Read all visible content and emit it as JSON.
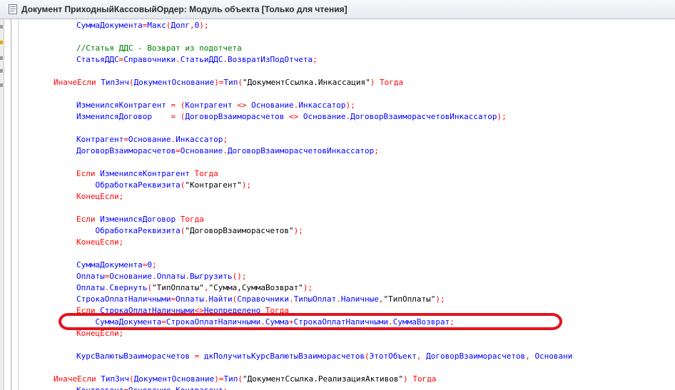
{
  "window": {
    "title": "Документ ПриходныйКассовыйОрдер: Модуль объекта [Только для чтения]",
    "icon": "module-document-icon"
  },
  "accent_colors": {
    "keyword": "#ff0000",
    "identifier": "#0000ff",
    "comment": "#008000",
    "annotation": "#e0141e"
  },
  "code_lines": [
    [
      {
        "t": "СуммаДокумента",
        "c": "id"
      },
      {
        "t": "=",
        "c": "op"
      },
      {
        "t": "Макс",
        "c": "id"
      },
      {
        "t": "(",
        "c": "op"
      },
      {
        "t": "Долг",
        "c": "id"
      },
      {
        "t": ",",
        "c": "op"
      },
      {
        "t": "0",
        "c": "id"
      },
      {
        "t": ");",
        "c": "op"
      }
    ],
    [],
    [
      {
        "t": "//Статья ДДС - Возврат из подотчета",
        "c": "cm"
      }
    ],
    [
      {
        "t": "СтатьяДДС",
        "c": "id"
      },
      {
        "t": "=",
        "c": "op"
      },
      {
        "t": "Справочники",
        "c": "id"
      },
      {
        "t": ".",
        "c": "op"
      },
      {
        "t": "СтатьиДДС",
        "c": "id"
      },
      {
        "t": ".",
        "c": "op"
      },
      {
        "t": "ВозвратИзПодОтчета",
        "c": "id"
      },
      {
        "t": ";",
        "c": "op"
      }
    ],
    [],
    [
      {
        "t": "ИначеЕсли ",
        "c": "kw"
      },
      {
        "t": "ТипЗнч",
        "c": "id"
      },
      {
        "t": "(",
        "c": "op"
      },
      {
        "t": "ДокументОснование",
        "c": "id"
      },
      {
        "t": ")=",
        "c": "op"
      },
      {
        "t": "Тип",
        "c": "id"
      },
      {
        "t": "(",
        "c": "op"
      },
      {
        "t": "\"ДокументСсылка.Инкассация\"",
        "c": "str"
      },
      {
        "t": ") ",
        "c": "op"
      },
      {
        "t": "Тогда",
        "c": "kw"
      }
    ],
    [],
    [
      {
        "t": "ИзменилсяКонтрагент",
        "c": "id"
      },
      {
        "t": " = ",
        "c": "op"
      },
      {
        "t": "(",
        "c": "op"
      },
      {
        "t": "Контрагент",
        "c": "id"
      },
      {
        "t": " <> ",
        "c": "op"
      },
      {
        "t": "Основание",
        "c": "id"
      },
      {
        "t": ".",
        "c": "op"
      },
      {
        "t": "Инкассатор",
        "c": "id"
      },
      {
        "t": ");",
        "c": "op"
      }
    ],
    [
      {
        "t": "ИзменилсяДоговор",
        "c": "id"
      },
      {
        "t": "    = ",
        "c": "op"
      },
      {
        "t": "(",
        "c": "op"
      },
      {
        "t": "ДоговорВзаиморасчетов",
        "c": "id"
      },
      {
        "t": " <> ",
        "c": "op"
      },
      {
        "t": "Основание",
        "c": "id"
      },
      {
        "t": ".",
        "c": "op"
      },
      {
        "t": "ДоговорВзаиморасчетовИнкассатор",
        "c": "id"
      },
      {
        "t": ");",
        "c": "op"
      }
    ],
    [],
    [
      {
        "t": "Контрагент",
        "c": "id"
      },
      {
        "t": "=",
        "c": "op"
      },
      {
        "t": "Основание",
        "c": "id"
      },
      {
        "t": ".",
        "c": "op"
      },
      {
        "t": "Инкассатор",
        "c": "id"
      },
      {
        "t": ";",
        "c": "op"
      }
    ],
    [
      {
        "t": "ДоговорВзаиморасчетов",
        "c": "id"
      },
      {
        "t": "=",
        "c": "op"
      },
      {
        "t": "Основание",
        "c": "id"
      },
      {
        "t": ".",
        "c": "op"
      },
      {
        "t": "ДоговорВзаиморасчетовИнкассатор",
        "c": "id"
      },
      {
        "t": ";",
        "c": "op"
      }
    ],
    [],
    [
      {
        "t": "Если ",
        "c": "kw"
      },
      {
        "t": "ИзменилсяКонтрагент",
        "c": "id"
      },
      {
        "t": " Тогда",
        "c": "kw"
      }
    ],
    [
      {
        "t": "    ОбработкаРеквизита",
        "c": "id"
      },
      {
        "t": "(",
        "c": "op"
      },
      {
        "t": "\"Контрагент\"",
        "c": "str"
      },
      {
        "t": ");",
        "c": "op"
      }
    ],
    [
      {
        "t": "КонецЕсли",
        "c": "kw"
      },
      {
        "t": ";",
        "c": "op"
      }
    ],
    [],
    [
      {
        "t": "Если ",
        "c": "kw"
      },
      {
        "t": "ИзменилсяДоговор",
        "c": "id"
      },
      {
        "t": " Тогда",
        "c": "kw"
      }
    ],
    [
      {
        "t": "    ОбработкаРеквизита",
        "c": "id"
      },
      {
        "t": "(",
        "c": "op"
      },
      {
        "t": "\"ДоговорВзаиморасчетов\"",
        "c": "str"
      },
      {
        "t": ");",
        "c": "op"
      }
    ],
    [
      {
        "t": "КонецЕсли",
        "c": "kw"
      },
      {
        "t": ";",
        "c": "op"
      }
    ],
    [],
    [
      {
        "t": "СуммаДокумента",
        "c": "id"
      },
      {
        "t": "=",
        "c": "op"
      },
      {
        "t": "0",
        "c": "id"
      },
      {
        "t": ";",
        "c": "op"
      }
    ],
    [
      {
        "t": "Оплаты",
        "c": "id"
      },
      {
        "t": "=",
        "c": "op"
      },
      {
        "t": "Основание",
        "c": "id"
      },
      {
        "t": ".",
        "c": "op"
      },
      {
        "t": "Оплаты",
        "c": "id"
      },
      {
        "t": ".",
        "c": "op"
      },
      {
        "t": "Выгрузить",
        "c": "id"
      },
      {
        "t": "();",
        "c": "op"
      }
    ],
    [
      {
        "t": "Оплаты",
        "c": "id"
      },
      {
        "t": ".",
        "c": "op"
      },
      {
        "t": "Свернуть",
        "c": "id"
      },
      {
        "t": "(",
        "c": "op"
      },
      {
        "t": "\"ТипОплаты\"",
        "c": "str"
      },
      {
        "t": ",",
        "c": "op"
      },
      {
        "t": "\"Сумма,СуммаВозврат\"",
        "c": "str"
      },
      {
        "t": ");",
        "c": "op"
      }
    ],
    [
      {
        "t": "СтрокаОплатНаличными",
        "c": "id"
      },
      {
        "t": "=",
        "c": "op"
      },
      {
        "t": "Оплаты",
        "c": "id"
      },
      {
        "t": ".",
        "c": "op"
      },
      {
        "t": "Найти",
        "c": "id"
      },
      {
        "t": "(",
        "c": "op"
      },
      {
        "t": "Справочники",
        "c": "id"
      },
      {
        "t": ".",
        "c": "op"
      },
      {
        "t": "ТипыОплат",
        "c": "id"
      },
      {
        "t": ".",
        "c": "op"
      },
      {
        "t": "Наличные",
        "c": "id"
      },
      {
        "t": ",",
        "c": "op"
      },
      {
        "t": "\"ТипОплаты\"",
        "c": "str"
      },
      {
        "t": ");",
        "c": "op"
      }
    ],
    [
      {
        "t": "Если ",
        "c": "kw"
      },
      {
        "t": "СтрокаОплатНаличными",
        "c": "id"
      },
      {
        "t": "<>",
        "c": "op"
      },
      {
        "t": "Неопределено",
        "c": "id"
      },
      {
        "t": " Тогда",
        "c": "kw"
      }
    ],
    [
      {
        "t": "    СуммаДокумента",
        "c": "id"
      },
      {
        "t": "=",
        "c": "op"
      },
      {
        "t": "СтрокаОплатНаличными",
        "c": "id"
      },
      {
        "t": ".",
        "c": "op"
      },
      {
        "t": "Сумма",
        "c": "id"
      },
      {
        "t": "+",
        "c": "op"
      },
      {
        "t": "СтрокаОплатНаличными",
        "c": "id"
      },
      {
        "t": ".",
        "c": "op"
      },
      {
        "t": "СуммаВозврат",
        "c": "id"
      },
      {
        "t": ";",
        "c": "op"
      }
    ],
    [
      {
        "t": "КонецЕсли",
        "c": "kw"
      },
      {
        "t": ";",
        "c": "op"
      }
    ],
    [],
    [
      {
        "t": "КурсВалютыВзаиморасчетов",
        "c": "id"
      },
      {
        "t": " = ",
        "c": "op"
      },
      {
        "t": "дкПолучитьКурсВалютыВзаиморасчетов",
        "c": "id"
      },
      {
        "t": "(",
        "c": "op"
      },
      {
        "t": "ЭтотОбъект",
        "c": "id"
      },
      {
        "t": ", ",
        "c": "op"
      },
      {
        "t": "ДоговорВзаиморасчетов",
        "c": "id"
      },
      {
        "t": ", ",
        "c": "op"
      },
      {
        "t": "Основани",
        "c": "id"
      }
    ],
    [],
    [
      {
        "t": "ИначеЕсли ",
        "c": "kw"
      },
      {
        "t": "ТипЗнч",
        "c": "id"
      },
      {
        "t": "(",
        "c": "op"
      },
      {
        "t": "ДокументОснование",
        "c": "id"
      },
      {
        "t": ")=",
        "c": "op"
      },
      {
        "t": "Тип",
        "c": "id"
      },
      {
        "t": "(",
        "c": "op"
      },
      {
        "t": "\"ДокументСсылка.РеализацияАктивов\"",
        "c": "str"
      },
      {
        "t": ") ",
        "c": "op"
      },
      {
        "t": "Тогда",
        "c": "kw"
      }
    ],
    [
      {
        "t": "Контрагент",
        "c": "id"
      },
      {
        "t": "=",
        "c": "op"
      },
      {
        "t": "Основание",
        "c": "id"
      },
      {
        "t": ".",
        "c": "op"
      },
      {
        "t": "Контрагент",
        "c": "id"
      },
      {
        "t": ";",
        "c": "op"
      }
    ]
  ],
  "highlighted_line_index": 26
}
